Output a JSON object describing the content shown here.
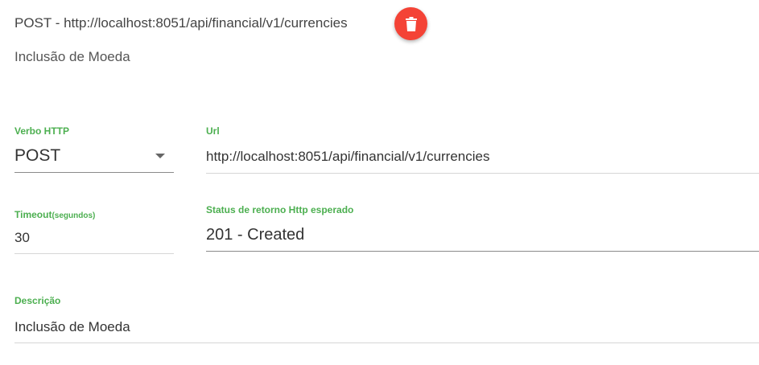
{
  "header": {
    "title": "POST - http://localhost:8051/api/financial/v1/currencies",
    "subtitle": "Inclusão de Moeda",
    "delete_icon": "trash-icon",
    "delete_color": "#f44336"
  },
  "form": {
    "accent_color": "#4caf50",
    "verb": {
      "label": "Verbo HTTP",
      "value": "POST"
    },
    "url": {
      "label": "Url",
      "value": "http://localhost:8051/api/financial/v1/currencies"
    },
    "timeout": {
      "label": "Timeout",
      "label_suffix": "(segundos)",
      "value": "30"
    },
    "status": {
      "label": "Status de retorno Http esperado",
      "value": "201 - Created"
    },
    "description": {
      "label": "Descrição",
      "value": "Inclusão de Moeda"
    }
  }
}
